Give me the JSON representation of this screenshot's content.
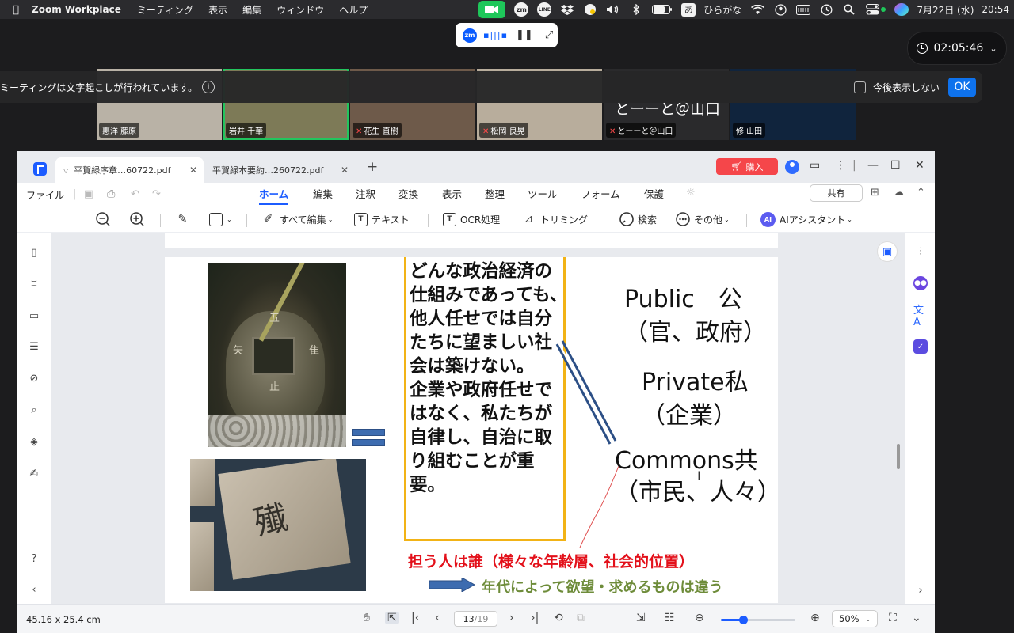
{
  "menubar": {
    "app_name": "Zoom Workplace",
    "menus": [
      "ミーティング",
      "表示",
      "編集",
      "ウィンドウ",
      "ヘルプ"
    ],
    "status_icons": [
      "zoom-video-icon",
      "zoom-app-icon",
      "line-icon",
      "dropbox-icon",
      "hand-sync-icon",
      "volume-icon",
      "bluetooth-icon",
      "battery-icon"
    ],
    "ime_char": "あ",
    "ime_label": "ひらがな",
    "date": "7月22日 (水)",
    "time": "20:54",
    "zm_label": "zm",
    "line_label": "LINE"
  },
  "zoom": {
    "timer": "02:05:46",
    "caption_notice": "ミーティングは文字起こしが行われています。",
    "dont_show_label": "今後表示しない",
    "ok_label": "OK",
    "participants": [
      {
        "name": "惠洋 藤原",
        "muted": false,
        "speaking": false,
        "bg": "#b9b2a6"
      },
      {
        "name": "岩井 千華",
        "muted": false,
        "speaking": true,
        "bg": "#7d7a57"
      },
      {
        "name": "花生 直樹",
        "muted": true,
        "speaking": false,
        "bg": "#6e5a4a"
      },
      {
        "name": "松岡 良晃",
        "muted": true,
        "speaking": false,
        "bg": "#b8ad9c"
      },
      {
        "name": "とーーと＠山口",
        "muted": true,
        "speaking": false,
        "bg": "#2a2a2c",
        "big_label": "とーーと＠山口"
      },
      {
        "name": "修 山田",
        "muted": false,
        "speaking": false,
        "bg": "#10243d"
      }
    ]
  },
  "pdf": {
    "tabs": [
      {
        "label": "平賀緑序章…60722.pdf",
        "active": true
      },
      {
        "label": "平賀緑本要約…260722.pdf",
        "active": false
      }
    ],
    "buy_label": "購入",
    "file_menu": "ファイル",
    "ribbon_tabs": [
      "ホーム",
      "編集",
      "注釈",
      "変換",
      "表示",
      "整理",
      "ツール",
      "フォーム",
      "保護"
    ],
    "active_ribbon_tab": "ホーム",
    "share_label": "共有",
    "tools": {
      "edit_all": "すべて編集",
      "text": "テキスト",
      "ocr": "OCR処理",
      "trim": "トリミング",
      "search": "検索",
      "more": "その他",
      "ai": "AIアシスタント",
      "ai_badge": "AI",
      "ocr_badge": "T",
      "text_badge": "T"
    },
    "slide": {
      "box_text": "どんな政治経済の仕組みであっても、他人任せでは自分たちに望ましい社会は築けない。\n企業や政府任せではなく、私たちが自律し、自治に取り組むことが重要。",
      "public_1": "Public　公",
      "public_2": "（官、政府）",
      "private_1": "Private私",
      "private_2": "（企業）",
      "commons_1": "Commons共",
      "commons_2": "（市民、人々）",
      "red_line": "担う人は誰（様々な年齢層、社会的位置）",
      "green_line": "年代によって欲望・求めるものは違う",
      "lantern_char": "殱",
      "basin_chars": [
        "五",
        "隹",
        "止",
        "矢"
      ],
      "colors": {
        "red": "#e3101a",
        "green": "#6e8c3a",
        "frame": "#f2b316",
        "accent": "#3d6cb0"
      }
    },
    "status": {
      "dimensions": "45.16 x 25.4 cm",
      "current_page": "13",
      "total_pages": "/19",
      "zoom": "50%",
      "zoom_fraction": 0.3
    }
  }
}
